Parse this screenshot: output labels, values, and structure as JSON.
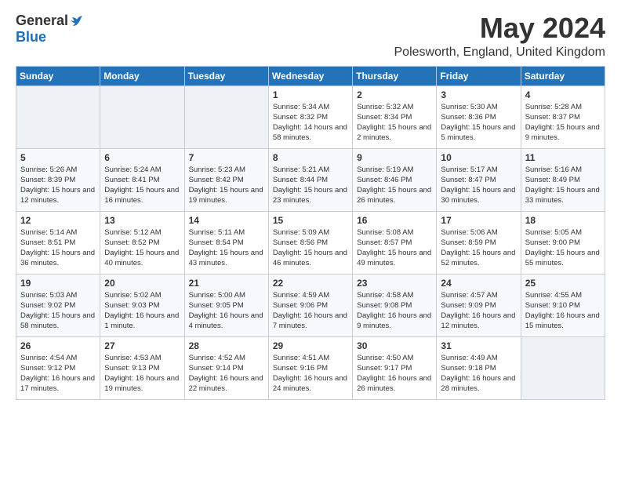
{
  "logo": {
    "general": "General",
    "blue": "Blue"
  },
  "title": "May 2024",
  "location": "Polesworth, England, United Kingdom",
  "days_of_week": [
    "Sunday",
    "Monday",
    "Tuesday",
    "Wednesday",
    "Thursday",
    "Friday",
    "Saturday"
  ],
  "weeks": [
    [
      {
        "day": "",
        "info": ""
      },
      {
        "day": "",
        "info": ""
      },
      {
        "day": "",
        "info": ""
      },
      {
        "day": "1",
        "info": "Sunrise: 5:34 AM\nSunset: 8:32 PM\nDaylight: 14 hours\nand 58 minutes."
      },
      {
        "day": "2",
        "info": "Sunrise: 5:32 AM\nSunset: 8:34 PM\nDaylight: 15 hours\nand 2 minutes."
      },
      {
        "day": "3",
        "info": "Sunrise: 5:30 AM\nSunset: 8:36 PM\nDaylight: 15 hours\nand 5 minutes."
      },
      {
        "day": "4",
        "info": "Sunrise: 5:28 AM\nSunset: 8:37 PM\nDaylight: 15 hours\nand 9 minutes."
      }
    ],
    [
      {
        "day": "5",
        "info": "Sunrise: 5:26 AM\nSunset: 8:39 PM\nDaylight: 15 hours\nand 12 minutes."
      },
      {
        "day": "6",
        "info": "Sunrise: 5:24 AM\nSunset: 8:41 PM\nDaylight: 15 hours\nand 16 minutes."
      },
      {
        "day": "7",
        "info": "Sunrise: 5:23 AM\nSunset: 8:42 PM\nDaylight: 15 hours\nand 19 minutes."
      },
      {
        "day": "8",
        "info": "Sunrise: 5:21 AM\nSunset: 8:44 PM\nDaylight: 15 hours\nand 23 minutes."
      },
      {
        "day": "9",
        "info": "Sunrise: 5:19 AM\nSunset: 8:46 PM\nDaylight: 15 hours\nand 26 minutes."
      },
      {
        "day": "10",
        "info": "Sunrise: 5:17 AM\nSunset: 8:47 PM\nDaylight: 15 hours\nand 30 minutes."
      },
      {
        "day": "11",
        "info": "Sunrise: 5:16 AM\nSunset: 8:49 PM\nDaylight: 15 hours\nand 33 minutes."
      }
    ],
    [
      {
        "day": "12",
        "info": "Sunrise: 5:14 AM\nSunset: 8:51 PM\nDaylight: 15 hours\nand 36 minutes."
      },
      {
        "day": "13",
        "info": "Sunrise: 5:12 AM\nSunset: 8:52 PM\nDaylight: 15 hours\nand 40 minutes."
      },
      {
        "day": "14",
        "info": "Sunrise: 5:11 AM\nSunset: 8:54 PM\nDaylight: 15 hours\nand 43 minutes."
      },
      {
        "day": "15",
        "info": "Sunrise: 5:09 AM\nSunset: 8:56 PM\nDaylight: 15 hours\nand 46 minutes."
      },
      {
        "day": "16",
        "info": "Sunrise: 5:08 AM\nSunset: 8:57 PM\nDaylight: 15 hours\nand 49 minutes."
      },
      {
        "day": "17",
        "info": "Sunrise: 5:06 AM\nSunset: 8:59 PM\nDaylight: 15 hours\nand 52 minutes."
      },
      {
        "day": "18",
        "info": "Sunrise: 5:05 AM\nSunset: 9:00 PM\nDaylight: 15 hours\nand 55 minutes."
      }
    ],
    [
      {
        "day": "19",
        "info": "Sunrise: 5:03 AM\nSunset: 9:02 PM\nDaylight: 15 hours\nand 58 minutes."
      },
      {
        "day": "20",
        "info": "Sunrise: 5:02 AM\nSunset: 9:03 PM\nDaylight: 16 hours\nand 1 minute."
      },
      {
        "day": "21",
        "info": "Sunrise: 5:00 AM\nSunset: 9:05 PM\nDaylight: 16 hours\nand 4 minutes."
      },
      {
        "day": "22",
        "info": "Sunrise: 4:59 AM\nSunset: 9:06 PM\nDaylight: 16 hours\nand 7 minutes."
      },
      {
        "day": "23",
        "info": "Sunrise: 4:58 AM\nSunset: 9:08 PM\nDaylight: 16 hours\nand 9 minutes."
      },
      {
        "day": "24",
        "info": "Sunrise: 4:57 AM\nSunset: 9:09 PM\nDaylight: 16 hours\nand 12 minutes."
      },
      {
        "day": "25",
        "info": "Sunrise: 4:55 AM\nSunset: 9:10 PM\nDaylight: 16 hours\nand 15 minutes."
      }
    ],
    [
      {
        "day": "26",
        "info": "Sunrise: 4:54 AM\nSunset: 9:12 PM\nDaylight: 16 hours\nand 17 minutes."
      },
      {
        "day": "27",
        "info": "Sunrise: 4:53 AM\nSunset: 9:13 PM\nDaylight: 16 hours\nand 19 minutes."
      },
      {
        "day": "28",
        "info": "Sunrise: 4:52 AM\nSunset: 9:14 PM\nDaylight: 16 hours\nand 22 minutes."
      },
      {
        "day": "29",
        "info": "Sunrise: 4:51 AM\nSunset: 9:16 PM\nDaylight: 16 hours\nand 24 minutes."
      },
      {
        "day": "30",
        "info": "Sunrise: 4:50 AM\nSunset: 9:17 PM\nDaylight: 16 hours\nand 26 minutes."
      },
      {
        "day": "31",
        "info": "Sunrise: 4:49 AM\nSunset: 9:18 PM\nDaylight: 16 hours\nand 28 minutes."
      },
      {
        "day": "",
        "info": ""
      }
    ]
  ]
}
